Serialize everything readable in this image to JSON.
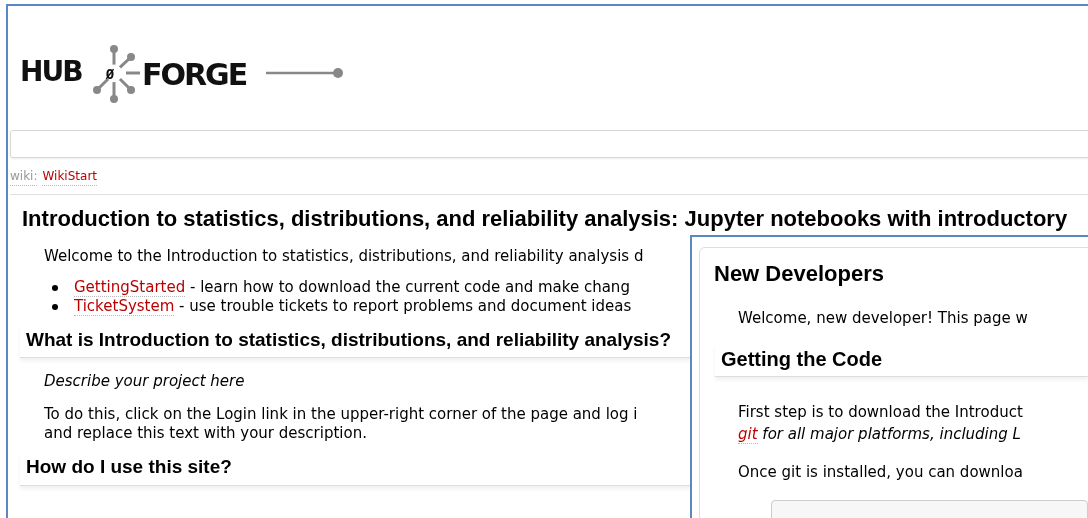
{
  "logo": {
    "left": "HUB",
    "middle": "Ø",
    "right": "FORGE"
  },
  "breadcrumb": {
    "prefix": "wiki:",
    "link": "WikiStart"
  },
  "page": {
    "title": "Introduction to statistics, distributions, and reliability analysis: Jupyter notebooks with introductory",
    "intro": "Welcome to the Introduction to statistics, distributions, and reliability analysis d",
    "links": [
      {
        "link": "GettingStarted",
        "text": " - learn how to download the current code and make chang"
      },
      {
        "link": "TicketSystem",
        "text": " - use trouble tickets to report problems and document ideas"
      }
    ],
    "sections": [
      {
        "heading": "What is Introduction to statistics, distributions, and reliability analysis?",
        "paragraphs": [
          {
            "kind": "italic",
            "lines": [
              "Describe your project here"
            ]
          },
          {
            "kind": "plain",
            "lines": [
              "To do this, click on the Login link in the upper-right corner of the page and log i",
              "and replace this text with your description."
            ]
          }
        ]
      },
      {
        "heading": "How do I use this site?"
      }
    ]
  },
  "inset": {
    "title": "New Developers",
    "welcome": "Welcome, new developer! This page w",
    "heading": "Getting the Code",
    "step_lines": [
      "First step is to download the Introduct"
    ],
    "git_link": "git",
    "git_text": " for all major platforms, including L",
    "install_text": "Once git is installed, you can downloa"
  }
}
